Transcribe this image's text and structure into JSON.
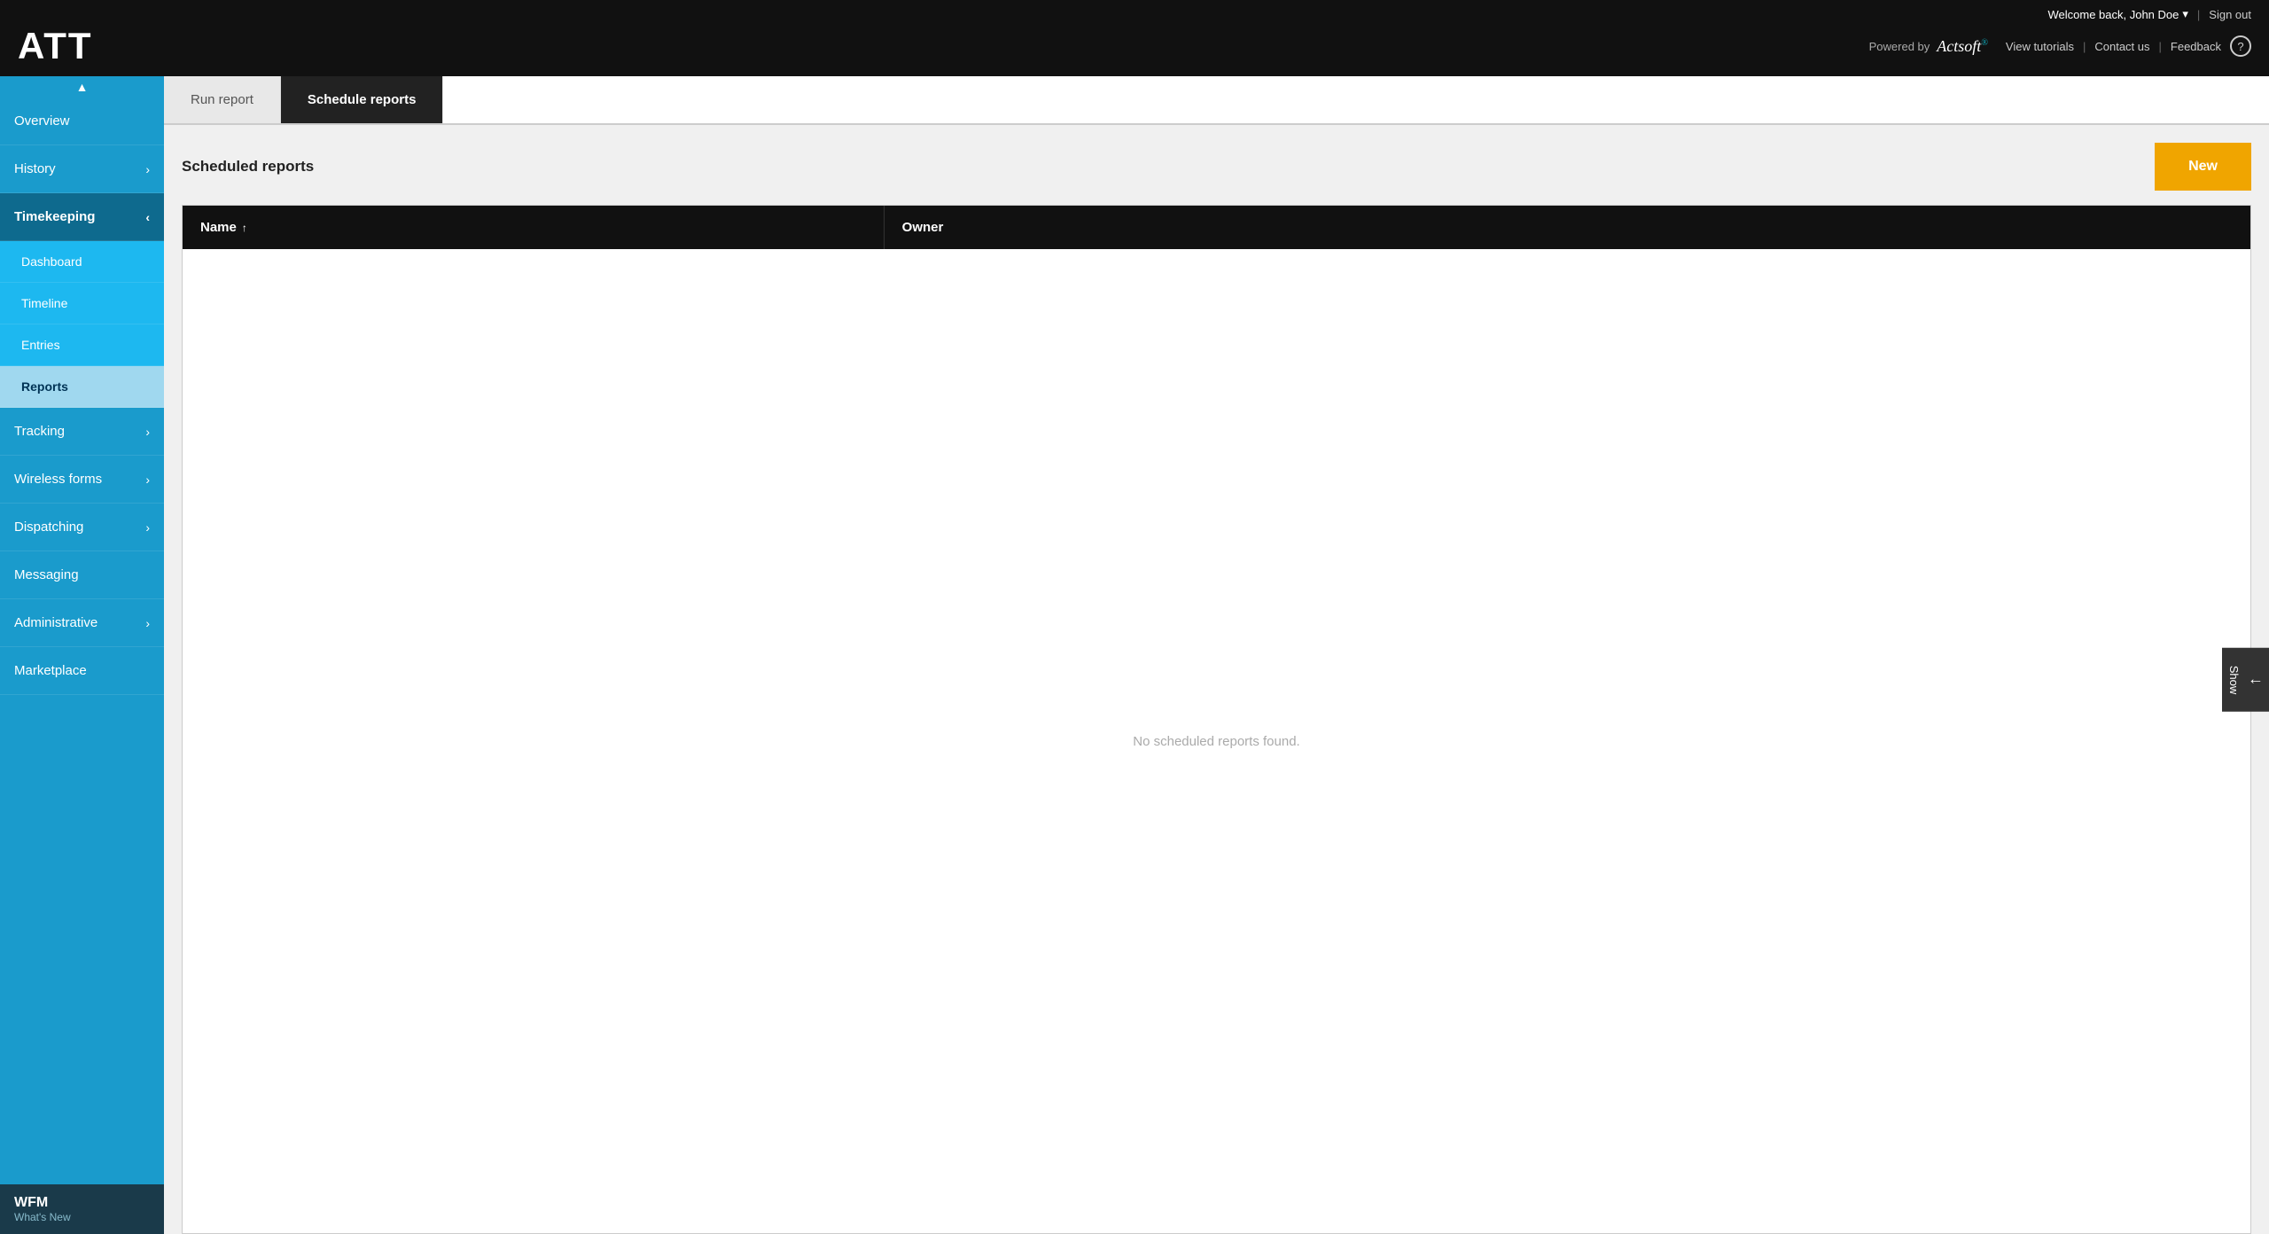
{
  "header": {
    "logo": "ATT",
    "welcome_text": "Welcome back, John Doe",
    "chevron": "▾",
    "divider": "|",
    "sign_out": "Sign out",
    "powered_by": "Powered by",
    "actsoft": "Actsoft",
    "view_tutorials": "View tutorials",
    "contact_us": "Contact us",
    "feedback": "Feedback",
    "help": "?"
  },
  "sidebar": {
    "scroll_up": "▲",
    "items": [
      {
        "label": "Overview",
        "has_arrow": false,
        "active": false
      },
      {
        "label": "History",
        "has_arrow": true,
        "active": false
      },
      {
        "label": "Timekeeping",
        "has_arrow": true,
        "active": true,
        "expanded": true
      },
      {
        "label": "Dashboard",
        "sub": true,
        "active": false
      },
      {
        "label": "Timeline",
        "sub": true,
        "active": false
      },
      {
        "label": "Entries",
        "sub": true,
        "active": false
      },
      {
        "label": "Reports",
        "sub": true,
        "active": true
      },
      {
        "label": "Tracking",
        "has_arrow": true,
        "active": false
      },
      {
        "label": "Wireless forms",
        "has_arrow": true,
        "active": false
      },
      {
        "label": "Dispatching",
        "has_arrow": true,
        "active": false
      },
      {
        "label": "Messaging",
        "has_arrow": false,
        "active": false
      },
      {
        "label": "Administrative",
        "has_arrow": true,
        "active": false
      },
      {
        "label": "Marketplace",
        "has_arrow": false,
        "active": false
      }
    ],
    "bottom": {
      "title": "WFM",
      "subtitle": "What's New"
    }
  },
  "tabs": [
    {
      "label": "Run report",
      "active": false
    },
    {
      "label": "Schedule reports",
      "active": true
    }
  ],
  "main": {
    "section_title": "Scheduled reports",
    "new_button": "New",
    "table": {
      "columns": [
        {
          "label": "Name",
          "sort_icon": "↑"
        },
        {
          "label": "Owner"
        }
      ],
      "empty_message": "No scheduled reports found."
    },
    "side_tab": {
      "arrow": "←",
      "label": "Show"
    }
  }
}
